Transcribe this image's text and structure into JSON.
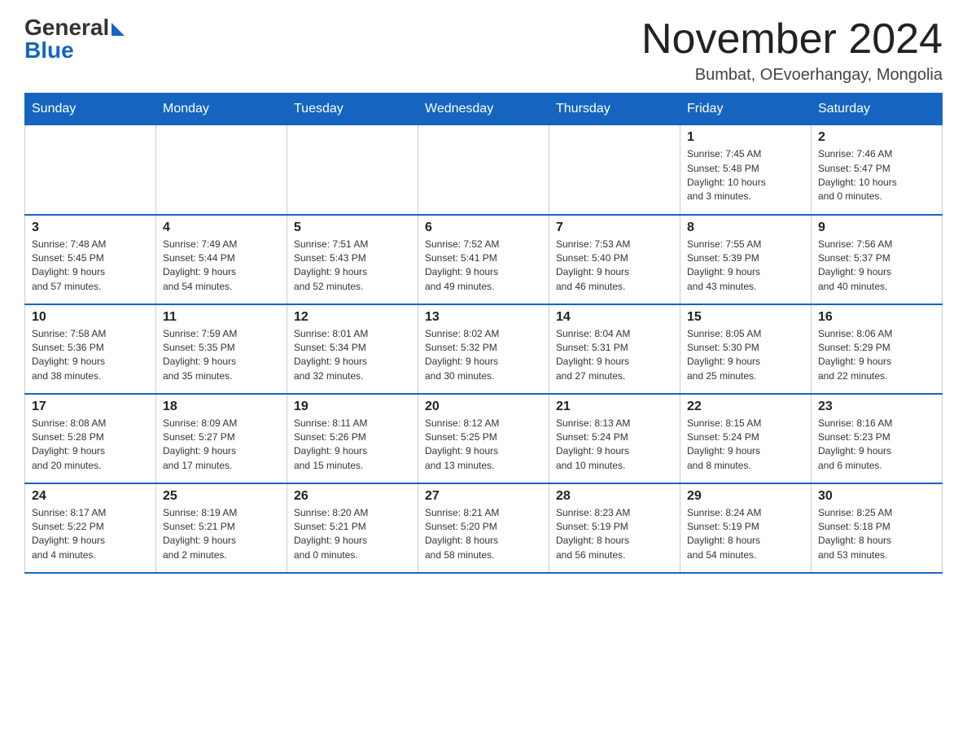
{
  "logo": {
    "general": "General",
    "blue": "Blue"
  },
  "header": {
    "month_title": "November 2024",
    "subtitle": "Bumbat, OEvoerhangay, Mongolia"
  },
  "weekdays": [
    "Sunday",
    "Monday",
    "Tuesday",
    "Wednesday",
    "Thursday",
    "Friday",
    "Saturday"
  ],
  "weeks": [
    [
      {
        "day": "",
        "info": ""
      },
      {
        "day": "",
        "info": ""
      },
      {
        "day": "",
        "info": ""
      },
      {
        "day": "",
        "info": ""
      },
      {
        "day": "",
        "info": ""
      },
      {
        "day": "1",
        "info": "Sunrise: 7:45 AM\nSunset: 5:48 PM\nDaylight: 10 hours\nand 3 minutes."
      },
      {
        "day": "2",
        "info": "Sunrise: 7:46 AM\nSunset: 5:47 PM\nDaylight: 10 hours\nand 0 minutes."
      }
    ],
    [
      {
        "day": "3",
        "info": "Sunrise: 7:48 AM\nSunset: 5:45 PM\nDaylight: 9 hours\nand 57 minutes."
      },
      {
        "day": "4",
        "info": "Sunrise: 7:49 AM\nSunset: 5:44 PM\nDaylight: 9 hours\nand 54 minutes."
      },
      {
        "day": "5",
        "info": "Sunrise: 7:51 AM\nSunset: 5:43 PM\nDaylight: 9 hours\nand 52 minutes."
      },
      {
        "day": "6",
        "info": "Sunrise: 7:52 AM\nSunset: 5:41 PM\nDaylight: 9 hours\nand 49 minutes."
      },
      {
        "day": "7",
        "info": "Sunrise: 7:53 AM\nSunset: 5:40 PM\nDaylight: 9 hours\nand 46 minutes."
      },
      {
        "day": "8",
        "info": "Sunrise: 7:55 AM\nSunset: 5:39 PM\nDaylight: 9 hours\nand 43 minutes."
      },
      {
        "day": "9",
        "info": "Sunrise: 7:56 AM\nSunset: 5:37 PM\nDaylight: 9 hours\nand 40 minutes."
      }
    ],
    [
      {
        "day": "10",
        "info": "Sunrise: 7:58 AM\nSunset: 5:36 PM\nDaylight: 9 hours\nand 38 minutes."
      },
      {
        "day": "11",
        "info": "Sunrise: 7:59 AM\nSunset: 5:35 PM\nDaylight: 9 hours\nand 35 minutes."
      },
      {
        "day": "12",
        "info": "Sunrise: 8:01 AM\nSunset: 5:34 PM\nDaylight: 9 hours\nand 32 minutes."
      },
      {
        "day": "13",
        "info": "Sunrise: 8:02 AM\nSunset: 5:32 PM\nDaylight: 9 hours\nand 30 minutes."
      },
      {
        "day": "14",
        "info": "Sunrise: 8:04 AM\nSunset: 5:31 PM\nDaylight: 9 hours\nand 27 minutes."
      },
      {
        "day": "15",
        "info": "Sunrise: 8:05 AM\nSunset: 5:30 PM\nDaylight: 9 hours\nand 25 minutes."
      },
      {
        "day": "16",
        "info": "Sunrise: 8:06 AM\nSunset: 5:29 PM\nDaylight: 9 hours\nand 22 minutes."
      }
    ],
    [
      {
        "day": "17",
        "info": "Sunrise: 8:08 AM\nSunset: 5:28 PM\nDaylight: 9 hours\nand 20 minutes."
      },
      {
        "day": "18",
        "info": "Sunrise: 8:09 AM\nSunset: 5:27 PM\nDaylight: 9 hours\nand 17 minutes."
      },
      {
        "day": "19",
        "info": "Sunrise: 8:11 AM\nSunset: 5:26 PM\nDaylight: 9 hours\nand 15 minutes."
      },
      {
        "day": "20",
        "info": "Sunrise: 8:12 AM\nSunset: 5:25 PM\nDaylight: 9 hours\nand 13 minutes."
      },
      {
        "day": "21",
        "info": "Sunrise: 8:13 AM\nSunset: 5:24 PM\nDaylight: 9 hours\nand 10 minutes."
      },
      {
        "day": "22",
        "info": "Sunrise: 8:15 AM\nSunset: 5:24 PM\nDaylight: 9 hours\nand 8 minutes."
      },
      {
        "day": "23",
        "info": "Sunrise: 8:16 AM\nSunset: 5:23 PM\nDaylight: 9 hours\nand 6 minutes."
      }
    ],
    [
      {
        "day": "24",
        "info": "Sunrise: 8:17 AM\nSunset: 5:22 PM\nDaylight: 9 hours\nand 4 minutes."
      },
      {
        "day": "25",
        "info": "Sunrise: 8:19 AM\nSunset: 5:21 PM\nDaylight: 9 hours\nand 2 minutes."
      },
      {
        "day": "26",
        "info": "Sunrise: 8:20 AM\nSunset: 5:21 PM\nDaylight: 9 hours\nand 0 minutes."
      },
      {
        "day": "27",
        "info": "Sunrise: 8:21 AM\nSunset: 5:20 PM\nDaylight: 8 hours\nand 58 minutes."
      },
      {
        "day": "28",
        "info": "Sunrise: 8:23 AM\nSunset: 5:19 PM\nDaylight: 8 hours\nand 56 minutes."
      },
      {
        "day": "29",
        "info": "Sunrise: 8:24 AM\nSunset: 5:19 PM\nDaylight: 8 hours\nand 54 minutes."
      },
      {
        "day": "30",
        "info": "Sunrise: 8:25 AM\nSunset: 5:18 PM\nDaylight: 8 hours\nand 53 minutes."
      }
    ]
  ]
}
